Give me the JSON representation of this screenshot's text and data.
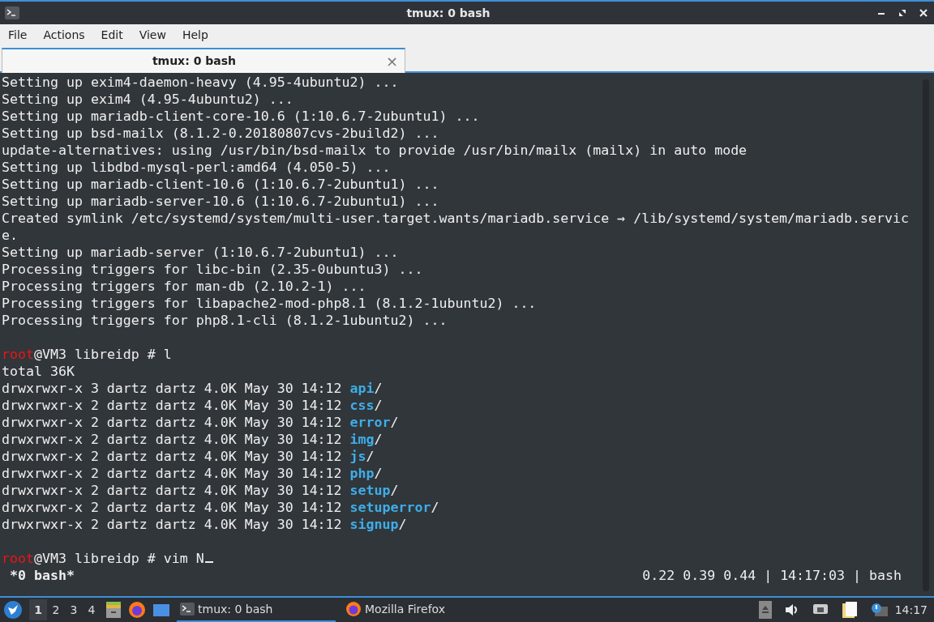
{
  "window": {
    "title": "tmux: 0 bash"
  },
  "menu": [
    "File",
    "Actions",
    "Edit",
    "View",
    "Help"
  ],
  "tabs": [
    {
      "label": "tmux: 0 bash",
      "selected": true,
      "close": "×"
    }
  ],
  "terminal": {
    "lines": [
      {
        "kind": "text",
        "segments": [
          {
            "kind": "plain",
            "text": "Setting up exim4-daemon-heavy (4.95-4ubuntu2) ..."
          }
        ]
      },
      {
        "kind": "text",
        "segments": [
          {
            "kind": "plain",
            "text": "Setting up exim4 (4.95-4ubuntu2) ..."
          }
        ]
      },
      {
        "kind": "text",
        "segments": [
          {
            "kind": "plain",
            "text": "Setting up mariadb-client-core-10.6 (1:10.6.7-2ubuntu1) ..."
          }
        ]
      },
      {
        "kind": "text",
        "segments": [
          {
            "kind": "plain",
            "text": "Setting up bsd-mailx (8.1.2-0.20180807cvs-2build2) ..."
          }
        ]
      },
      {
        "kind": "text",
        "segments": [
          {
            "kind": "plain",
            "text": "update-alternatives: using /usr/bin/bsd-mailx to provide /usr/bin/mailx (mailx) in auto mode"
          }
        ]
      },
      {
        "kind": "text",
        "segments": [
          {
            "kind": "plain",
            "text": "Setting up libdbd-mysql-perl:amd64 (4.050-5) ..."
          }
        ]
      },
      {
        "kind": "text",
        "segments": [
          {
            "kind": "plain",
            "text": "Setting up mariadb-client-10.6 (1:10.6.7-2ubuntu1) ..."
          }
        ]
      },
      {
        "kind": "text",
        "segments": [
          {
            "kind": "plain",
            "text": "Setting up mariadb-server-10.6 (1:10.6.7-2ubuntu1) ..."
          }
        ]
      },
      {
        "kind": "text",
        "segments": [
          {
            "kind": "plain",
            "text": "Created symlink /etc/systemd/system/multi-user.target.wants/mariadb.service → /lib/systemd/system/mariadb.servic"
          }
        ]
      },
      {
        "kind": "text",
        "segments": [
          {
            "kind": "plain",
            "text": "e."
          }
        ]
      },
      {
        "kind": "text",
        "segments": [
          {
            "kind": "plain",
            "text": "Setting up mariadb-server (1:10.6.7-2ubuntu1) ..."
          }
        ]
      },
      {
        "kind": "text",
        "segments": [
          {
            "kind": "plain",
            "text": "Processing triggers for libc-bin (2.35-0ubuntu3) ..."
          }
        ]
      },
      {
        "kind": "text",
        "segments": [
          {
            "kind": "plain",
            "text": "Processing triggers for man-db (2.10.2-1) ..."
          }
        ]
      },
      {
        "kind": "text",
        "segments": [
          {
            "kind": "plain",
            "text": "Processing triggers for libapache2-mod-php8.1 (8.1.2-1ubuntu2) ..."
          }
        ]
      },
      {
        "kind": "text",
        "segments": [
          {
            "kind": "plain",
            "text": "Processing triggers for php8.1-cli (8.1.2-1ubuntu2) ..."
          }
        ]
      },
      {
        "kind": "blank"
      },
      {
        "kind": "prompt",
        "segments": [
          {
            "kind": "user",
            "text": "root"
          },
          {
            "kind": "plain",
            "text": "@VM3 libreidp # l"
          }
        ]
      },
      {
        "kind": "text",
        "segments": [
          {
            "kind": "plain",
            "text": "total 36K"
          }
        ]
      },
      {
        "kind": "text",
        "segments": [
          {
            "kind": "plain",
            "text": "drwxrwxr-x 3 dartz dartz 4.0K May 30 14:12 "
          },
          {
            "kind": "dir",
            "text": "api"
          },
          {
            "kind": "plain",
            "text": "/"
          }
        ]
      },
      {
        "kind": "text",
        "segments": [
          {
            "kind": "plain",
            "text": "drwxrwxr-x 2 dartz dartz 4.0K May 30 14:12 "
          },
          {
            "kind": "dir",
            "text": "css"
          },
          {
            "kind": "plain",
            "text": "/"
          }
        ]
      },
      {
        "kind": "text",
        "segments": [
          {
            "kind": "plain",
            "text": "drwxrwxr-x 2 dartz dartz 4.0K May 30 14:12 "
          },
          {
            "kind": "dir",
            "text": "error"
          },
          {
            "kind": "plain",
            "text": "/"
          }
        ]
      },
      {
        "kind": "text",
        "segments": [
          {
            "kind": "plain",
            "text": "drwxrwxr-x 2 dartz dartz 4.0K May 30 14:12 "
          },
          {
            "kind": "dir",
            "text": "img"
          },
          {
            "kind": "plain",
            "text": "/"
          }
        ]
      },
      {
        "kind": "text",
        "segments": [
          {
            "kind": "plain",
            "text": "drwxrwxr-x 2 dartz dartz 4.0K May 30 14:12 "
          },
          {
            "kind": "dir",
            "text": "js"
          },
          {
            "kind": "plain",
            "text": "/"
          }
        ]
      },
      {
        "kind": "text",
        "segments": [
          {
            "kind": "plain",
            "text": "drwxrwxr-x 2 dartz dartz 4.0K May 30 14:12 "
          },
          {
            "kind": "dir",
            "text": "php"
          },
          {
            "kind": "plain",
            "text": "/"
          }
        ]
      },
      {
        "kind": "text",
        "segments": [
          {
            "kind": "plain",
            "text": "drwxrwxr-x 2 dartz dartz 4.0K May 30 14:12 "
          },
          {
            "kind": "dir",
            "text": "setup"
          },
          {
            "kind": "plain",
            "text": "/"
          }
        ]
      },
      {
        "kind": "text",
        "segments": [
          {
            "kind": "plain",
            "text": "drwxrwxr-x 2 dartz dartz 4.0K May 30 14:12 "
          },
          {
            "kind": "dir",
            "text": "setuperror"
          },
          {
            "kind": "plain",
            "text": "/"
          }
        ]
      },
      {
        "kind": "text",
        "segments": [
          {
            "kind": "plain",
            "text": "drwxrwxr-x 2 dartz dartz 4.0K May 30 14:12 "
          },
          {
            "kind": "dir",
            "text": "signup"
          },
          {
            "kind": "plain",
            "text": "/"
          }
        ]
      },
      {
        "kind": "blank"
      },
      {
        "kind": "prompt",
        "cursor": true,
        "segments": [
          {
            "kind": "user",
            "text": "root"
          },
          {
            "kind": "plain",
            "text": "@VM3 libreidp # vim N"
          }
        ]
      }
    ],
    "status_left": "*0 bash*",
    "status_right": "0.22 0.39 0.44 | 14:17:03 | bash"
  },
  "taskbar": {
    "desktops": [
      {
        "label": "1",
        "selected": true
      },
      {
        "label": "2",
        "selected": false
      },
      {
        "label": "3",
        "selected": false
      },
      {
        "label": "4",
        "selected": false
      }
    ],
    "tasks": [
      {
        "label": "tmux: 0 bash",
        "kind": "terminal",
        "selected": true
      },
      {
        "label": "Mozilla Firefox",
        "kind": "firefox",
        "selected": false
      }
    ],
    "clock": "14:17"
  }
}
